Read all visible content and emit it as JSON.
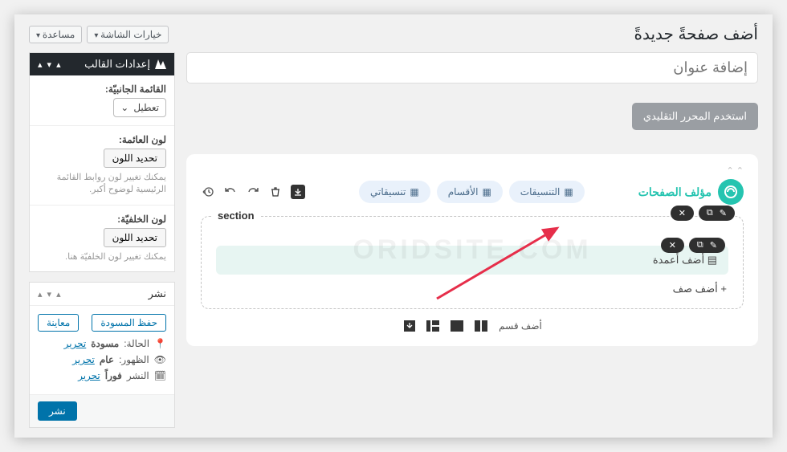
{
  "top": {
    "page_title": "أضف صفحةً جديدةً",
    "screen_options": "خيارات الشاشة",
    "help": "مساعدة"
  },
  "title_placeholder": "إضافة عنوان",
  "classic_editor_btn": "استخدم المحرر التقليدي",
  "composer": {
    "brand": "مؤلف الصفحات",
    "btn_layouts": "التنسيقات",
    "btn_sections": "الأقسام",
    "btn_mylayouts": "تنسيقاتي",
    "section_label": "section",
    "add_columns": "أضف أعمدة",
    "add_row": "أضف صف",
    "add_section": "أضف قسم"
  },
  "sidebar": {
    "theme_settings_title": "إعدادات القالب",
    "side_menu_label": "القائمة الجانبيّة:",
    "side_menu_value": "تعطيل",
    "floating_color_label": "لون العائمة:",
    "select_color": "تحديد اللون",
    "floating_hint": "يمكنك تغيير لون روابط القائمة الرئيسية لوضوح أكبر.",
    "bg_color_label": "لون الخلفيّة:",
    "bg_hint": "يمكنك تغيير لون الخلفيّة هنا.",
    "publish_title": "نشر",
    "save_draft": "حفظ المسودة",
    "preview": "معاينة",
    "status_label": "الحالة:",
    "status_value": "مسودة",
    "visibility_label": "الظهور:",
    "visibility_value": "عام",
    "publish_label": "النشر",
    "publish_value": "فوراً",
    "edit_link": "تحرير",
    "publish_btn": "نشر"
  },
  "watermark": "ORIDSITE.COM"
}
